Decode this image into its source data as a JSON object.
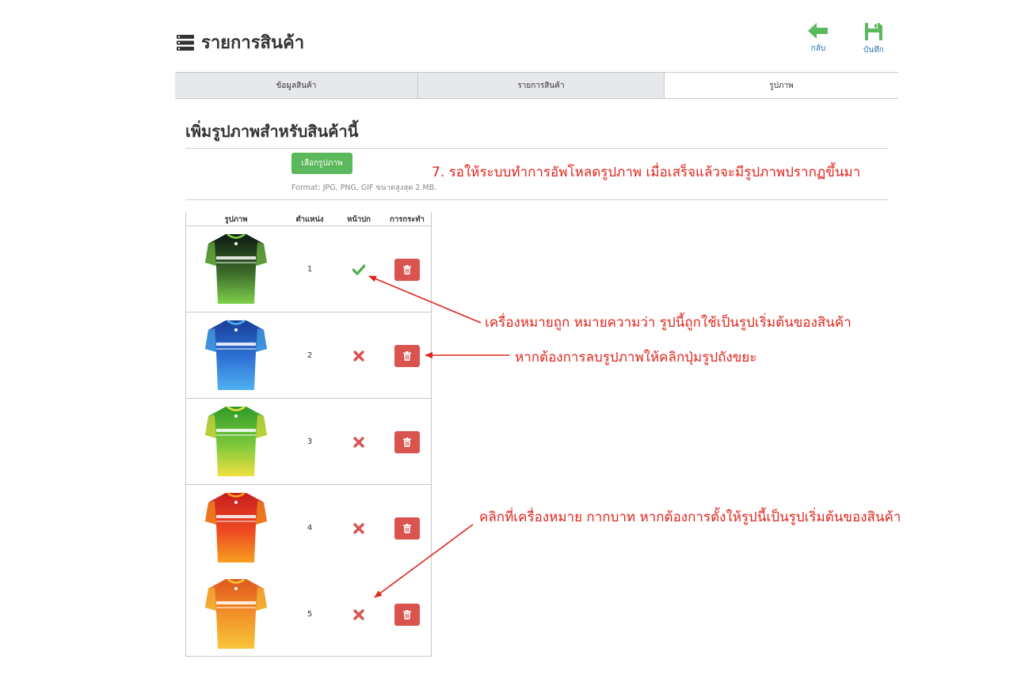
{
  "header": {
    "title": "รายการสินค้า",
    "title_icon": "list-icon",
    "back_label": "กลับ",
    "save_label": "บันทึก",
    "back_color": "#5cb85c",
    "save_color": "#5cb85c"
  },
  "tabs": [
    {
      "label": "ข้อมูลสินค้า",
      "active": false
    },
    {
      "label": "รายการสินค้า",
      "active": false
    },
    {
      "label": "รูปภาพ",
      "active": true
    }
  ],
  "upload": {
    "section_title": "เพิ่มรูปภาพสำหรับสินค้านี้",
    "choose_button": "เลือกรูปภาพ",
    "format_hint": "Format: JPG, PNG, GIF ขนาดสูงสุด 2 MB."
  },
  "table": {
    "headers": [
      "รูปภาพ",
      "ตำแหน่ง",
      "หน้าปก",
      "การกระทำ"
    ],
    "rows": [
      {
        "position": "1",
        "is_cover": true,
        "shirt_colors": [
          "#0e1a12",
          "#3b6a2a",
          "#7ed04a"
        ]
      },
      {
        "position": "2",
        "is_cover": false,
        "shirt_colors": [
          "#1a3f9a",
          "#2f74d8",
          "#4fb0f0"
        ]
      },
      {
        "position": "3",
        "is_cover": false,
        "shirt_colors": [
          "#2f9a2a",
          "#7cc83a",
          "#f0e040"
        ]
      },
      {
        "position": "4",
        "is_cover": false,
        "shirt_colors": [
          "#c81e1e",
          "#ee4a22",
          "#f7a020"
        ]
      },
      {
        "position": "5",
        "is_cover": false,
        "shirt_colors": [
          "#e0571e",
          "#f2962a",
          "#f8c53a"
        ]
      }
    ]
  },
  "annotations": {
    "step7": "7. รอให้ระบบทำการอัพโหลดรูปภาพ เมื่อเสร็จแล้วจะมีรูปภาพปรากฏขึ้นมา",
    "checkmark": "เครื่องหมายถูก หมายความว่า รูปนี้ถูกใช้เป็นรูปเริ่มต้นของสินค้า",
    "trash": "หากต้องการลบรูปภาพให้คลิกปุ่มรูปถังขยะ",
    "cross": "คลิกที่เครื่องหมาย กากบาท หากต้องการตั้งให้รูปนี้เป็นรูปเริ่มต้นของสินค้า",
    "color": "#e0241b"
  },
  "colors": {
    "check_green": "#4cae4c",
    "cross_red": "#d9534f",
    "delete_red": "#d9534f",
    "choose_green": "#5cb85c",
    "tab_inactive_bg": "#e6e8ec"
  }
}
